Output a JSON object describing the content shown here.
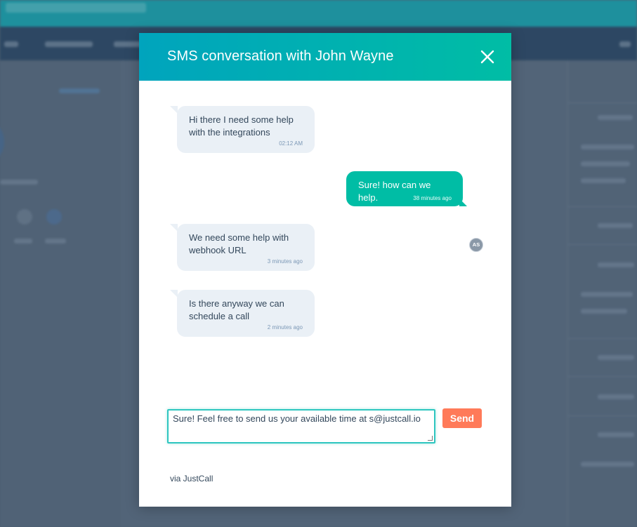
{
  "background": {
    "colors": {
      "topbar": "#1aa7b3",
      "navbar": "#2e4a68",
      "main": "#5d6f83"
    }
  },
  "modal": {
    "title": "SMS conversation with John Wayne",
    "close_icon": "close-icon",
    "header_gradient": [
      "#00a4bd",
      "#00bda5"
    ],
    "messages": [
      {
        "direction": "in",
        "text": "Hi there I need some help with the integrations",
        "time": "02:12 AM"
      },
      {
        "direction": "out",
        "text": "Sure! how can we help.",
        "time": "38 minutes ago",
        "avatar": "AS"
      },
      {
        "direction": "in",
        "text": "We need some help with webhook URL",
        "time": "3 minutes ago"
      },
      {
        "direction": "in",
        "text": "Is there anyway we can schedule a call",
        "time": "2 minutes ago"
      }
    ],
    "composer": {
      "value": "Sure! Feel free to send us your available time at s@justcall.io"
    },
    "send_label": "Send",
    "send_color": "#ff7a59",
    "via_label": "via JustCall"
  }
}
